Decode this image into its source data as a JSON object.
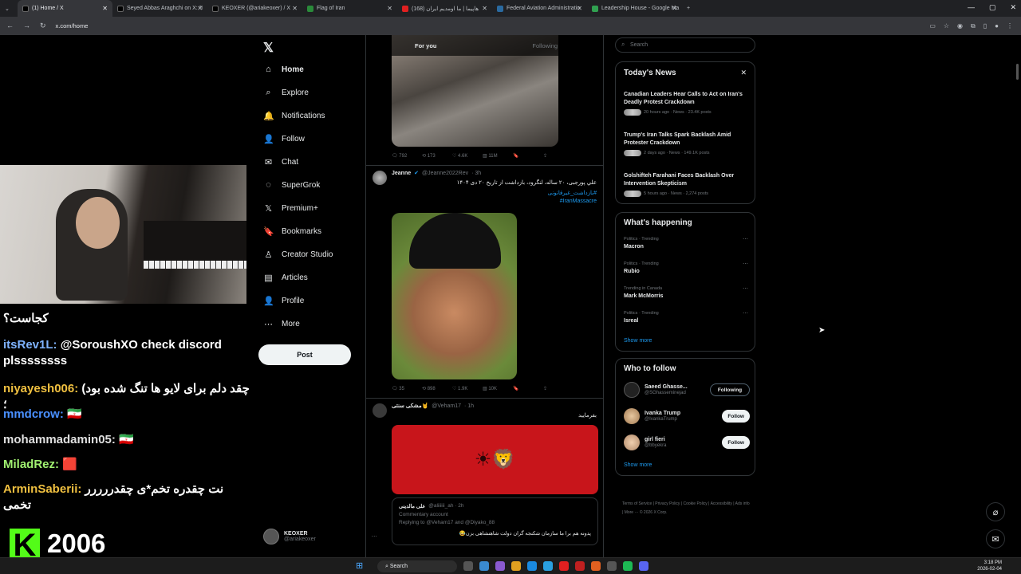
{
  "browser": {
    "tabs": [
      {
        "title": "(1) Home / X",
        "color": "#000000"
      },
      {
        "title": "Seyed Abbas Araghchi on X: \"I",
        "color": "#000000"
      },
      {
        "title": "KEOXER (@ariakeoxer) / X",
        "color": "#000000"
      },
      {
        "title": "Flag of Iran",
        "color": "#2a8a3a"
      },
      {
        "title": "هاپیما | ما اومدیم ایران (168)",
        "color": "#e02020"
      },
      {
        "title": "Federal Aviation Administratio",
        "color": "#2a6aa0"
      },
      {
        "title": "Leadership House - Google Ma",
        "color": "#30a050"
      }
    ],
    "new_tab": "+",
    "url": "x.com/home"
  },
  "sidebar": {
    "logo": "𝕏",
    "items": [
      {
        "label": "Home",
        "icon": "⌂"
      },
      {
        "label": "Explore",
        "icon": "⌕"
      },
      {
        "label": "Notifications",
        "icon": "🔔"
      },
      {
        "label": "Follow",
        "icon": "👤"
      },
      {
        "label": "Chat",
        "icon": "✉"
      },
      {
        "label": "SuperGrok",
        "icon": "◌"
      },
      {
        "label": "Premium+",
        "icon": "𝕏"
      },
      {
        "label": "Bookmarks",
        "icon": "🔖"
      },
      {
        "label": "Creator Studio",
        "icon": "♙"
      },
      {
        "label": "Articles",
        "icon": "▤"
      },
      {
        "label": "Profile",
        "icon": "👤"
      },
      {
        "label": "More",
        "icon": "⋯"
      }
    ],
    "post_button": "Post",
    "account": {
      "name": "KEOXER",
      "handle": "@ariakeoxer"
    }
  },
  "feed": {
    "tabs": {
      "for_you": "For you",
      "following": "Following"
    },
    "post1": {
      "replies": "792",
      "reposts": "173",
      "likes": "4.6K",
      "views": "11M"
    },
    "post2": {
      "name": "Jeanne",
      "handle": "@Jeanne2022Rev",
      "time": "· 3h",
      "text": "علي پورجبی، ۲۰ ساله، لنگرود، بازداشت از تاریخ ۲۰ دی ۱۴۰۴",
      "tag1": "#بازداشت_غیرقانونی",
      "tag2": "#IranMassacre",
      "replies": "35",
      "reposts": "898",
      "likes": "1.9K",
      "views": "10K"
    },
    "post3": {
      "name": "مشکی سنتی🤘",
      "handle": "@Veham17",
      "time": "· 1h",
      "text": "بفرمایید",
      "quote_name": "علی مالدینی",
      "quote_handle": "@aliiiiii_ah · 2h",
      "quote_label": "Commentary account",
      "quote_reply": "Replying to @Veham17 and @Diyako_88",
      "quote_text": "پدونه هم برا ما سازمان شکنجه گران دولت شاهنشاهی بزن😂"
    }
  },
  "right": {
    "search_placeholder": "Search",
    "todays_news": {
      "title": "Today's News",
      "items": [
        {
          "headline": "Canadian Leaders Hear Calls to Act on Iran's Deadly Protest Crackdown",
          "meta": "20 hours ago · News · 23.4K posts"
        },
        {
          "headline": "Trump's Iran Talks Spark Backlash Amid Protester Crackdown",
          "meta": "2 days ago · News · 149.1K posts"
        },
        {
          "headline": "Golshifteh Farahani Faces Backlash Over Intervention Skepticism",
          "meta": "5 hours ago · News · 2,274 posts"
        }
      ]
    },
    "whats_happening": {
      "title": "What's happening",
      "items": [
        {
          "context": "Politics · Trending",
          "topic": "Macron"
        },
        {
          "context": "Politics · Trending",
          "topic": "Rubio"
        },
        {
          "context": "Trending in Canada",
          "topic": "Mark McMorris"
        },
        {
          "context": "Politics · Trending",
          "topic": "Isreal"
        }
      ],
      "show_more": "Show more"
    },
    "who_to_follow": {
      "title": "Who to follow",
      "items": [
        {
          "name": "Saeed Ghasse...",
          "handle": "@SGhasseminejad",
          "button": "Following"
        },
        {
          "name": "Ivanka Trump",
          "handle": "@IvankaTrump",
          "button": "Follow"
        },
        {
          "name": "girl fieri",
          "handle": "@bbyekra",
          "button": "Follow"
        }
      ],
      "show_more": "Show more"
    },
    "footer": "Terms of Service | Privacy Policy | Cookie Policy | Accessibility | Ads info | More ··· © 2026 X Corp."
  },
  "stream": {
    "chat": [
      {
        "user": "",
        "msg": "کجاست؟"
      },
      {
        "user": "itsRev1L:",
        "msg": "@SoroushXO check discord plssssssss"
      },
      {
        "user": "niyayesh006:",
        "msg": "(چقد دلم برای لایو ها تنگ شده بود ؛"
      },
      {
        "user": "mmdcrow:",
        "msg": "🇮🇷"
      },
      {
        "user": "mohammadamin05:",
        "msg": "🇮🇷"
      },
      {
        "user": "MiladRez:",
        "msg": "🟥"
      },
      {
        "user": "ArminSaberii:",
        "msg": "نت چقدره تخم*ی چقدررررر تخمی"
      }
    ],
    "kick_logo": "K",
    "count": "2006"
  },
  "taskbar": {
    "search": "Search",
    "time": "3:18 PM",
    "date": "2026-02-04"
  }
}
